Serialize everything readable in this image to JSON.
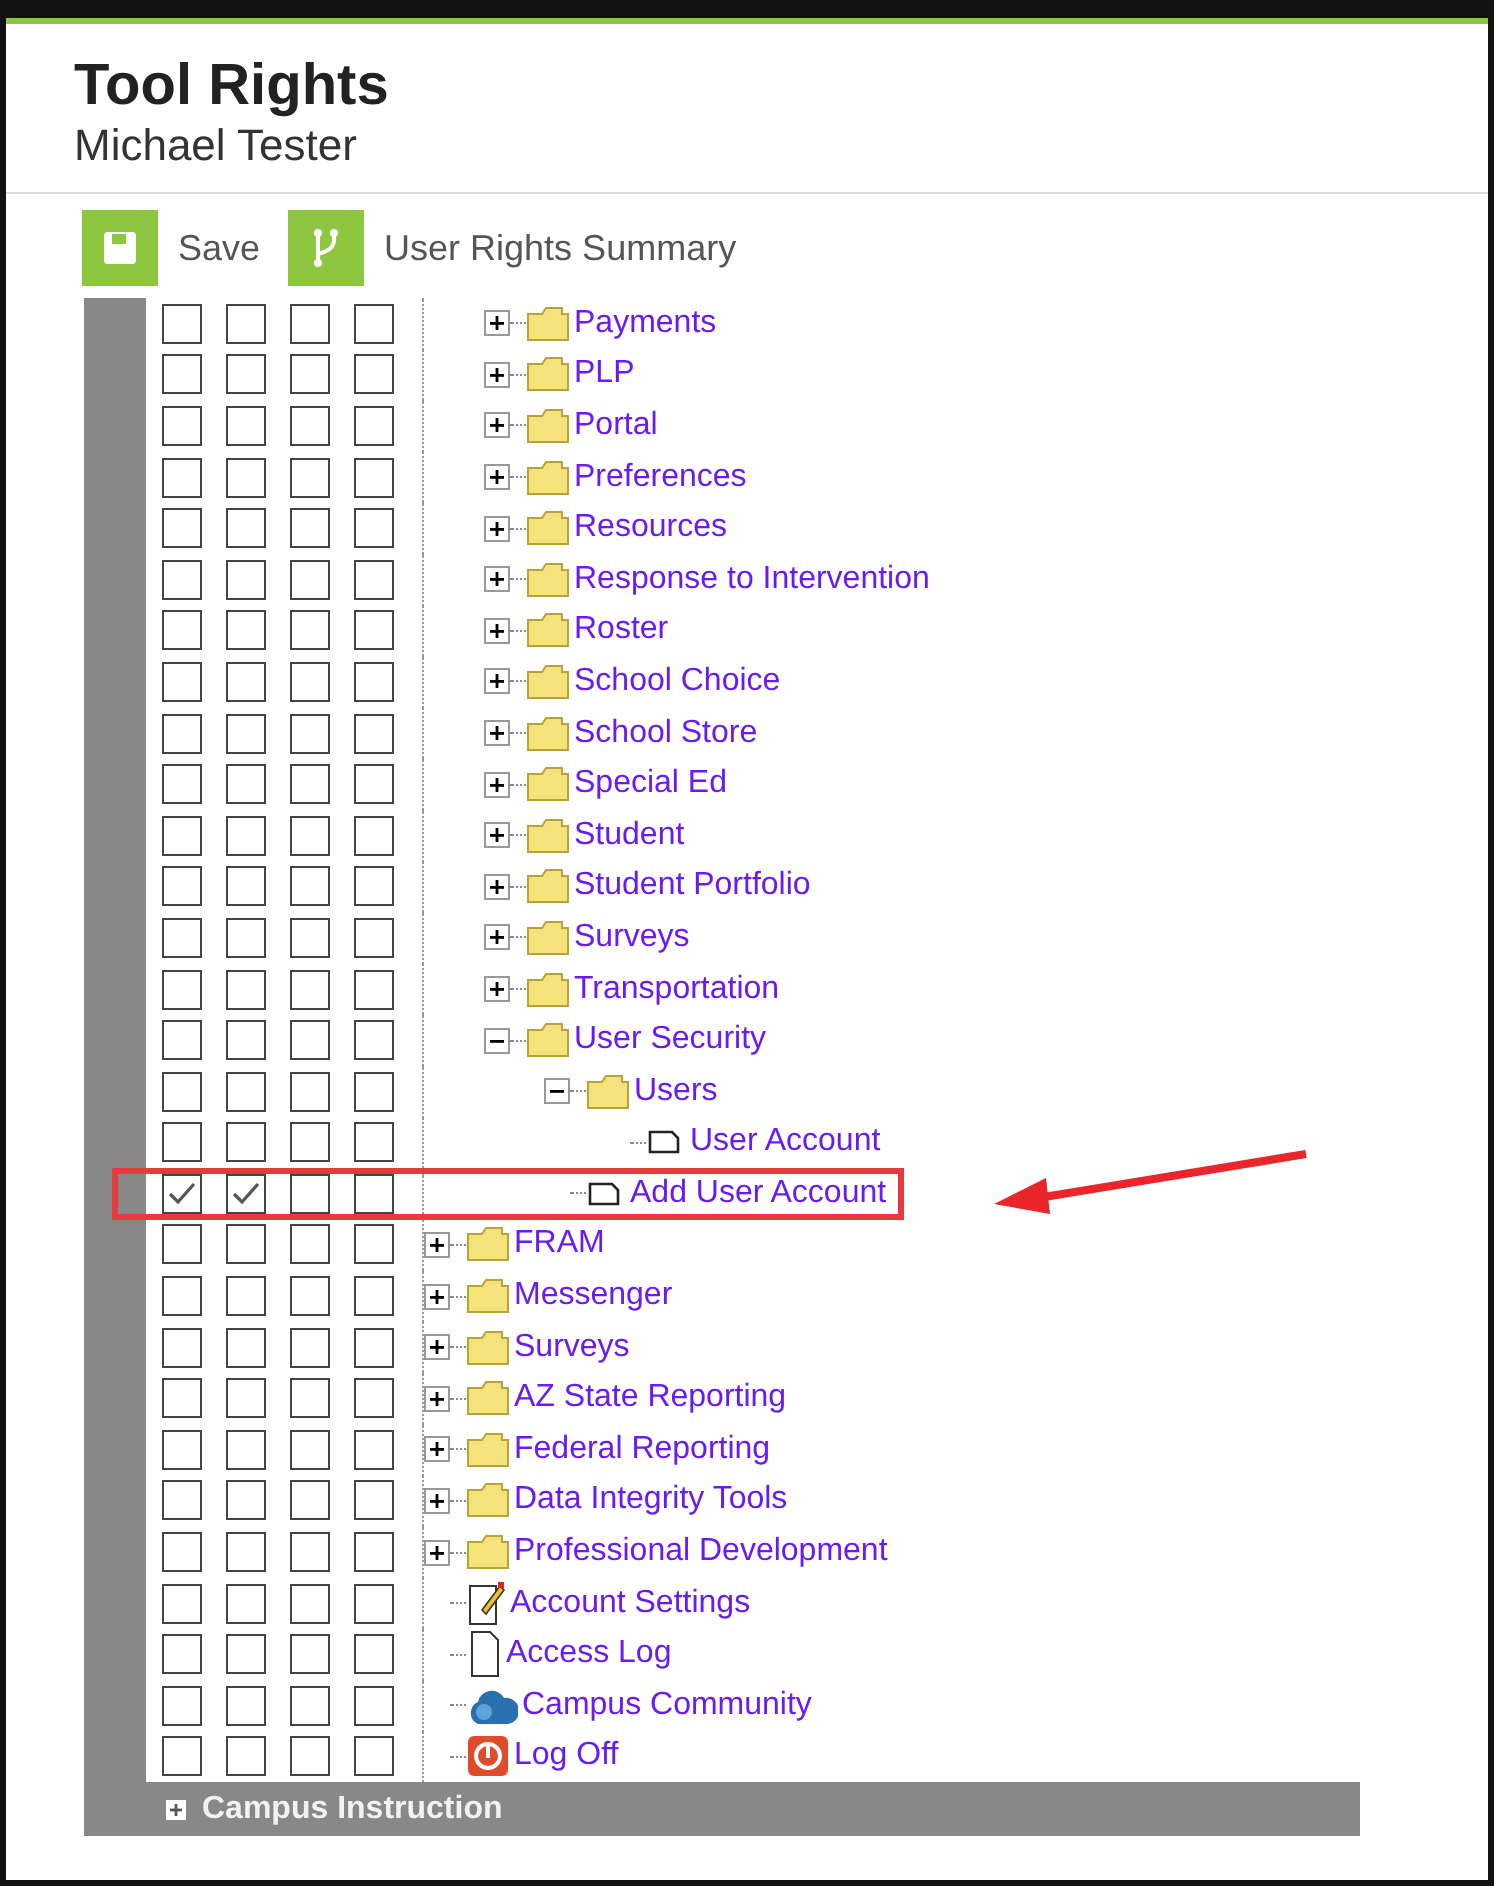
{
  "header": {
    "title": "Tool Rights",
    "user": "Michael Tester"
  },
  "toolbar": [
    {
      "kind": "save",
      "label": "Save"
    },
    {
      "kind": "summary",
      "label": "User Rights Summary"
    }
  ],
  "tree": [
    {
      "kind": "continued",
      "children": [
        {
          "kind": "folder",
          "label": "Payments",
          "expanded": false,
          "checks": [
            false,
            false,
            false,
            false
          ]
        },
        {
          "kind": "folder",
          "label": "PLP",
          "expanded": false,
          "checks": [
            false,
            false,
            false,
            false
          ]
        },
        {
          "kind": "folder",
          "label": "Portal",
          "expanded": false,
          "checks": [
            false,
            false,
            false,
            false
          ]
        },
        {
          "kind": "folder",
          "label": "Preferences",
          "expanded": false,
          "checks": [
            false,
            false,
            false,
            false
          ]
        },
        {
          "kind": "folder",
          "label": "Resources",
          "expanded": false,
          "checks": [
            false,
            false,
            false,
            false
          ]
        },
        {
          "kind": "folder",
          "label": "Response to Intervention",
          "expanded": false,
          "checks": [
            false,
            false,
            false,
            false
          ]
        },
        {
          "kind": "folder",
          "label": "Roster",
          "expanded": false,
          "checks": [
            false,
            false,
            false,
            false
          ]
        },
        {
          "kind": "folder",
          "label": "School Choice",
          "expanded": false,
          "checks": [
            false,
            false,
            false,
            false
          ]
        },
        {
          "kind": "folder",
          "label": "School Store",
          "expanded": false,
          "checks": [
            false,
            false,
            false,
            false
          ]
        },
        {
          "kind": "folder",
          "label": "Special Ed",
          "expanded": false,
          "checks": [
            false,
            false,
            false,
            false
          ]
        },
        {
          "kind": "folder",
          "label": "Student",
          "expanded": false,
          "checks": [
            false,
            false,
            false,
            false
          ]
        },
        {
          "kind": "folder",
          "label": "Student Portfolio",
          "expanded": false,
          "checks": [
            false,
            false,
            false,
            false
          ]
        },
        {
          "kind": "folder",
          "label": "Surveys",
          "expanded": false,
          "checks": [
            false,
            false,
            false,
            false
          ]
        },
        {
          "kind": "folder",
          "label": "Transportation",
          "expanded": false,
          "checks": [
            false,
            false,
            false,
            false
          ]
        },
        {
          "kind": "folder",
          "label": "User Security",
          "expanded": true,
          "checks": [
            false,
            false,
            false,
            false
          ],
          "children": [
            {
              "kind": "folder",
              "label": "Users",
              "expanded": true,
              "checks": [
                false,
                false,
                false,
                false
              ],
              "children": [
                {
                  "kind": "page",
                  "label": "User Account",
                  "checks": [
                    false,
                    false,
                    false,
                    false
                  ]
                }
              ]
            },
            {
              "kind": "page",
              "label": "Add User Account",
              "highlighted": true,
              "checks": [
                true,
                true,
                false,
                false
              ]
            }
          ]
        }
      ]
    },
    {
      "kind": "folder",
      "label": "FRAM",
      "expanded": false,
      "checks": [
        false,
        false,
        false,
        false
      ]
    },
    {
      "kind": "folder",
      "label": "Messenger",
      "expanded": false,
      "checks": [
        false,
        false,
        false,
        false
      ]
    },
    {
      "kind": "folder",
      "label": "Surveys",
      "expanded": false,
      "checks": [
        false,
        false,
        false,
        false
      ]
    },
    {
      "kind": "folder",
      "label": "AZ State Reporting",
      "expanded": false,
      "checks": [
        false,
        false,
        false,
        false
      ]
    },
    {
      "kind": "folder",
      "label": "Federal Reporting",
      "expanded": false,
      "checks": [
        false,
        false,
        false,
        false
      ]
    },
    {
      "kind": "folder",
      "label": "Data Integrity Tools",
      "expanded": false,
      "checks": [
        false,
        false,
        false,
        false
      ]
    },
    {
      "kind": "folder",
      "label": "Professional Development",
      "expanded": false,
      "checks": [
        false,
        false,
        false,
        false
      ]
    },
    {
      "kind": "notepad",
      "label": "Account Settings",
      "checks": [
        false,
        false,
        false,
        false
      ]
    },
    {
      "kind": "document",
      "label": "Access Log",
      "checks": [
        false,
        false,
        false,
        false
      ]
    },
    {
      "kind": "community",
      "label": "Campus Community",
      "checks": [
        false,
        false,
        false,
        false
      ]
    },
    {
      "kind": "power",
      "label": "Log Off",
      "checks": [
        false,
        false,
        false,
        false
      ]
    }
  ],
  "footer": {
    "label": "Campus Instruction",
    "expanded": false
  }
}
